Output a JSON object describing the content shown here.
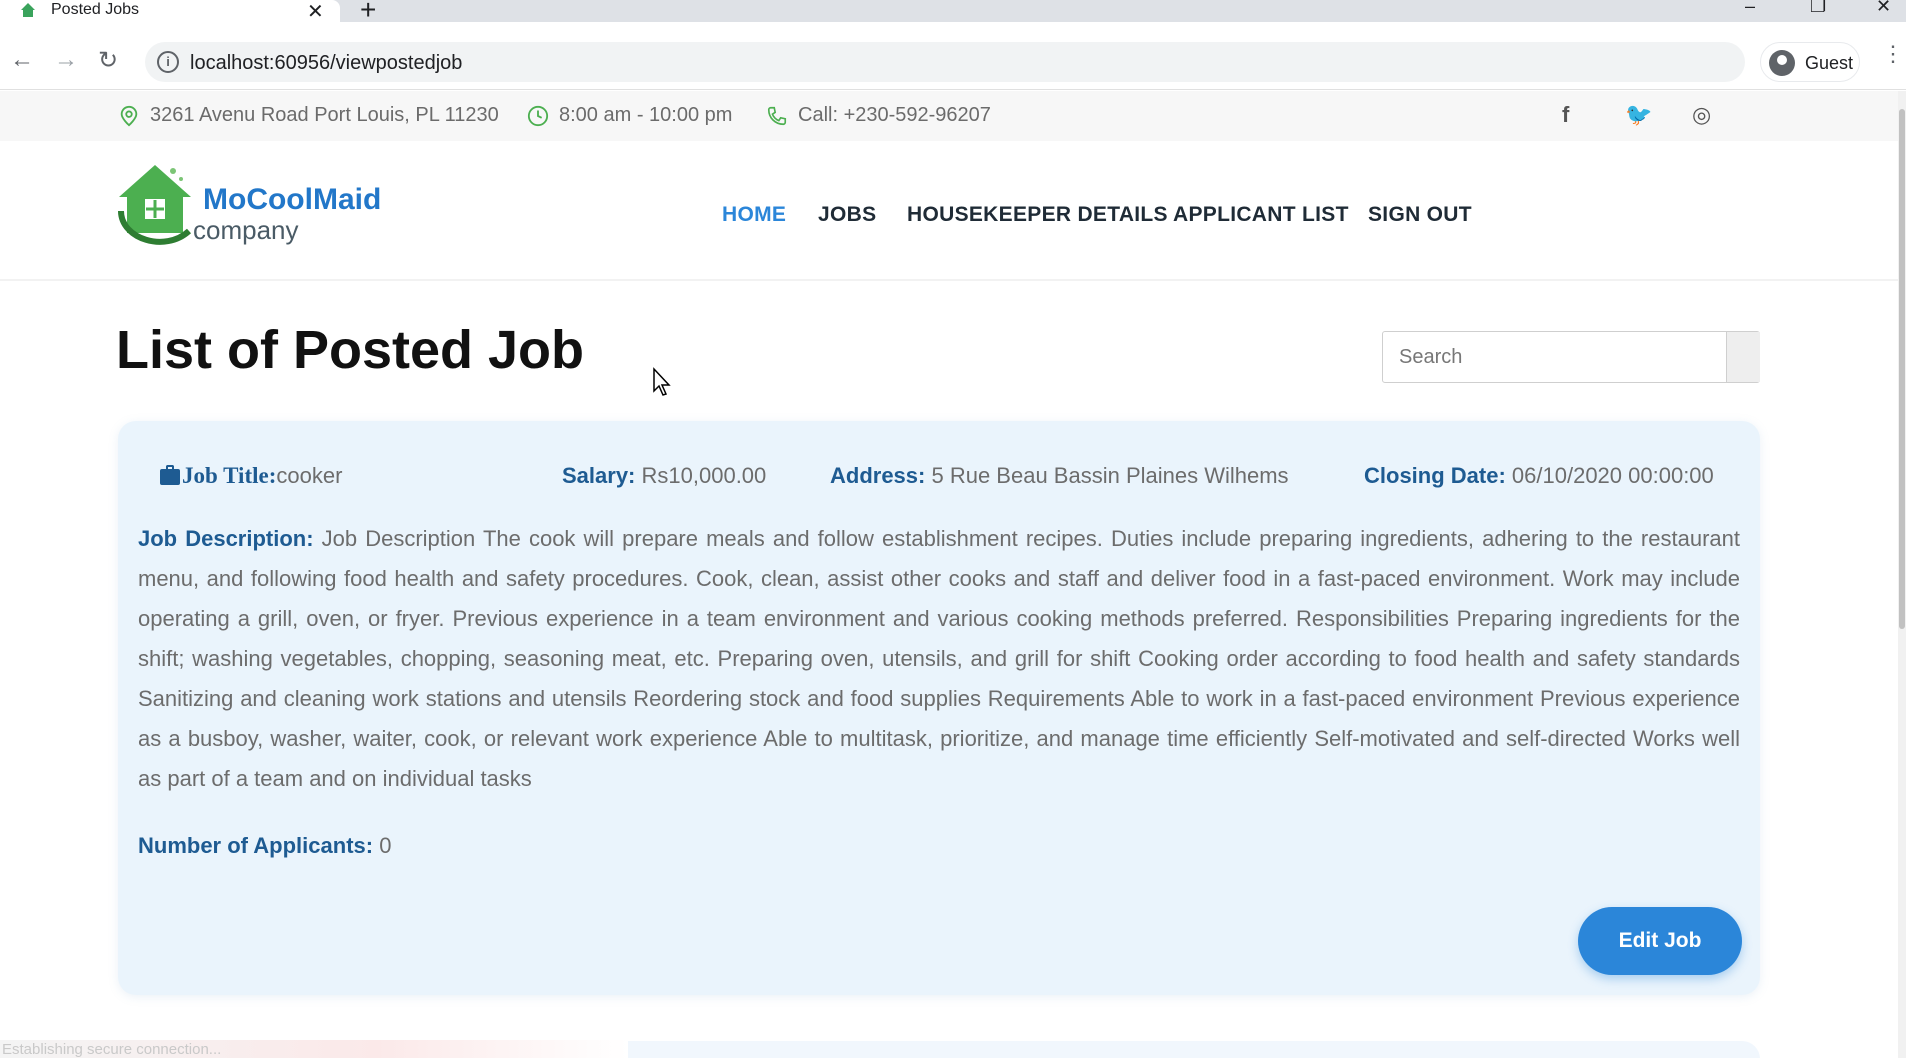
{
  "browser": {
    "tab_title": "Posted Jobs",
    "tab_close": "✕",
    "new_tab": "+",
    "url": "localhost:60956/viewpostedjob",
    "profile_label": "Guest",
    "back": "←",
    "forward": "→",
    "reload": "↻",
    "minimize": "–",
    "restore": "❐",
    "close": "✕",
    "menu": "⋮"
  },
  "topbar": {
    "address": "3261 Avenu Road Port Louis, PL 11230",
    "hours": "8:00 am - 10:00 pm",
    "phone": "Call: +230-592-96207",
    "social": [
      "f",
      "🐦",
      "◎"
    ]
  },
  "header": {
    "brand_name": "MoCoolMaid",
    "brand_sub": "company",
    "nav": [
      {
        "label": "HOME",
        "active": true
      },
      {
        "label": "JOBS",
        "active": false
      },
      {
        "label": "HOUSEKEEPER DETAILS",
        "active": false
      },
      {
        "label": "APPLICANT LIST",
        "active": false
      },
      {
        "label": "SIGN OUT",
        "active": false
      }
    ]
  },
  "main": {
    "title": "List of Posted Job",
    "search_placeholder": "Search"
  },
  "job": {
    "title_label": "Job Title:",
    "title_value": "cooker",
    "salary_label": "Salary:",
    "salary_value": "Rs10,000.00",
    "address_label": "Address:",
    "address_value": "5 Rue Beau Bassin Plaines Wilhems",
    "closing_label": "Closing Date:",
    "closing_value": "06/10/2020 00:00:00",
    "description_label": "Job Description:",
    "description_value": "Job Description The cook will prepare meals and follow establishment recipes. Duties include preparing ingredients, adhering to the restaurant menu, and following food health and safety procedures. Cook, clean, assist other cooks and staff and deliver food in a fast-paced environment. Work may include operating a grill, oven, or fryer. Previous experience in a team environment and various cooking methods preferred. Responsibilities Preparing ingredients for the shift; washing vegetables, chopping, seasoning meat, etc. Preparing oven, utensils, and grill for shift Cooking order according to food health and safety standards Sanitizing and cleaning work stations and utensils Reordering stock and food supplies Requirements Able to work in a fast-paced environment Previous experience as a busboy, washer, waiter, cook, or relevant work experience Able to multitask, prioritize, and manage time efficiently Self-motivated and self-directed Works well as part of a team and on individual tasks",
    "applicants_label": "Number of Applicants:",
    "applicants_value": "0",
    "edit_label": "Edit Job"
  },
  "status": {
    "text": "Establishing secure connection..."
  },
  "colors": {
    "accent": "#2b86d9",
    "label": "#1e5b92",
    "card_bg": "#eaf4fc"
  }
}
